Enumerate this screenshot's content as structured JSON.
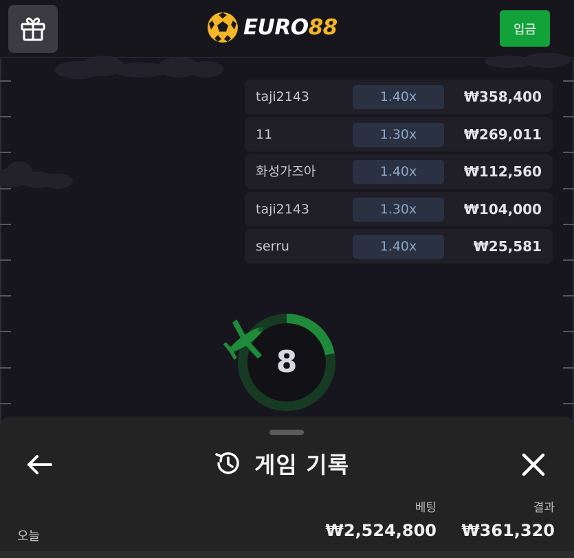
{
  "header": {
    "gift_icon": "gift-icon",
    "logo_white": "EURO",
    "logo_gold": "88",
    "deposit_label": "입금",
    "colors": {
      "deposit": "#13a13a",
      "logo_gold": "#f4b527"
    }
  },
  "bets": [
    {
      "name": "taji2143",
      "multiplier": "1.40x",
      "amount": "₩358,400"
    },
    {
      "name": "11",
      "multiplier": "1.30x",
      "amount": "₩269,011"
    },
    {
      "name": "화성가즈아",
      "multiplier": "1.40x",
      "amount": "₩112,560"
    },
    {
      "name": "taji2143",
      "multiplier": "1.30x",
      "amount": "₩104,000"
    },
    {
      "name": "serru",
      "multiplier": "1.40x",
      "amount": "₩25,581"
    }
  ],
  "countdown": {
    "value": "8",
    "progress": 0.22,
    "plane_icon": "airplane-icon",
    "color": "#1f8a3a"
  },
  "history_sheet": {
    "title": "게임 기록",
    "title_icon": "history-icon",
    "back_icon": "arrow-left-icon",
    "close_icon": "close-icon",
    "col_bet": "베팅",
    "col_result": "결과",
    "rows": [
      {
        "label": "오늘",
        "bet": "₩2,524,800",
        "result": "₩361,320"
      }
    ]
  }
}
